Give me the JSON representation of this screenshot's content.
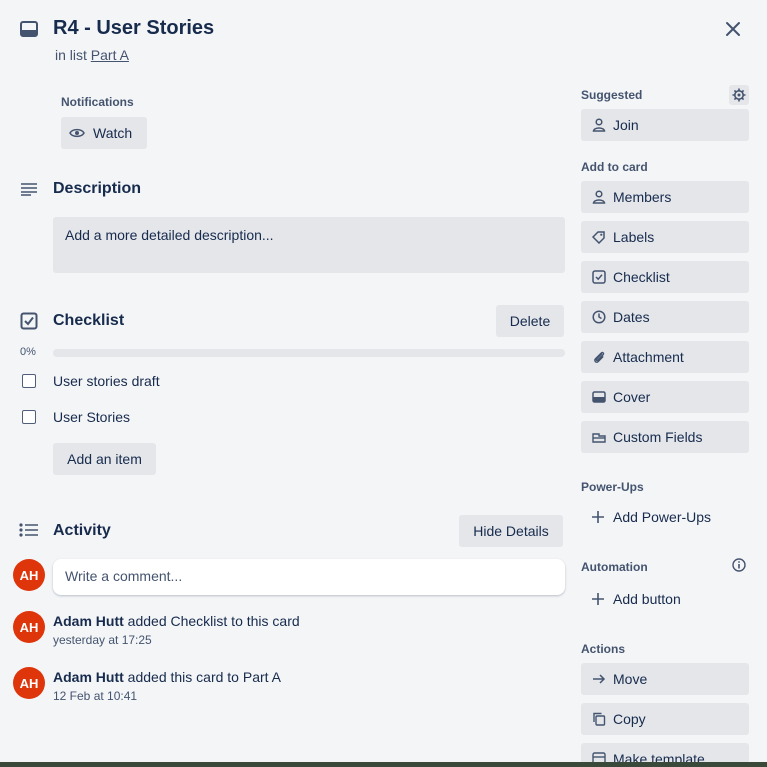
{
  "card": {
    "title": "R4 - User Stories",
    "in_list_prefix": "in list",
    "list_name": "Part A"
  },
  "notifications": {
    "heading": "Notifications",
    "watch_label": "Watch"
  },
  "description": {
    "heading": "Description",
    "placeholder": "Add a more detailed description..."
  },
  "checklist": {
    "heading": "Checklist",
    "delete_label": "Delete",
    "progress_text": "0%",
    "progress": 0,
    "items": [
      {
        "label": "User stories draft",
        "checked": false
      },
      {
        "label": "User Stories",
        "checked": false
      }
    ],
    "add_item_label": "Add an item"
  },
  "activity": {
    "heading": "Activity",
    "hide_details_label": "Hide Details",
    "comment_placeholder": "Write a comment...",
    "entries": [
      {
        "initials": "AH",
        "user": "Adam Hutt",
        "action": "added Checklist to this card",
        "time": "yesterday at 17:25"
      },
      {
        "initials": "AH",
        "user": "Adam Hutt",
        "action": "added this card to Part A",
        "time": "12 Feb at 10:41"
      }
    ],
    "current_user_initials": "AH"
  },
  "sidebar": {
    "suggested_heading": "Suggested",
    "join_label": "Join",
    "add_to_card_heading": "Add to card",
    "add_to_card": [
      {
        "label": "Members",
        "icon": "person-icon"
      },
      {
        "label": "Labels",
        "icon": "tag-icon"
      },
      {
        "label": "Checklist",
        "icon": "checkbox-icon"
      },
      {
        "label": "Dates",
        "icon": "clock-icon"
      },
      {
        "label": "Attachment",
        "icon": "paperclip-icon"
      },
      {
        "label": "Cover",
        "icon": "cover-icon"
      },
      {
        "label": "Custom Fields",
        "icon": "custom-fields-icon"
      }
    ],
    "powerups_heading": "Power-Ups",
    "add_powerups_label": "Add Power-Ups",
    "automation_heading": "Automation",
    "add_button_label": "Add button",
    "actions_heading": "Actions",
    "actions": [
      {
        "label": "Move",
        "icon": "arrow-right-icon"
      },
      {
        "label": "Copy",
        "icon": "copy-icon"
      },
      {
        "label": "Make template",
        "icon": "template-icon"
      }
    ]
  },
  "colors": {
    "background": "#f4f5f7",
    "button": "#e4e6ea",
    "avatar": "#de350b",
    "text": "#172b4d"
  }
}
